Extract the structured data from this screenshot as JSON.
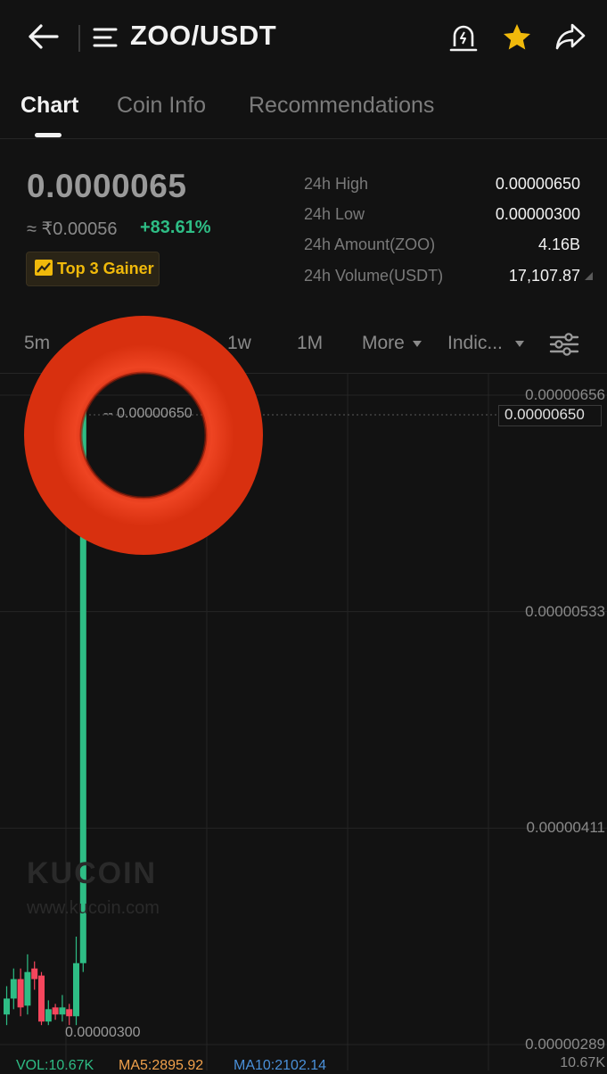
{
  "header": {
    "title": "ZOO/USDT"
  },
  "tabs": [
    {
      "label": "Chart",
      "active": true
    },
    {
      "label": "Coin Info",
      "active": false
    },
    {
      "label": "Recommendations",
      "active": false
    }
  ],
  "ticker": {
    "price": "0.0000065",
    "approx": "≈ ₹0.00056",
    "change": "+83.61%",
    "badge": "Top 3 Gainer",
    "stats": [
      {
        "label": "24h High",
        "value": "0.00000650"
      },
      {
        "label": "24h Low",
        "value": "0.00000300"
      },
      {
        "label": "24h Amount(ZOO)",
        "value": "4.16B"
      },
      {
        "label": "24h Volume(USDT)",
        "value": "17,107.87"
      }
    ]
  },
  "intervals": {
    "items": [
      "5m",
      "1w",
      "1M"
    ],
    "more": "More",
    "indicators": "Indic..."
  },
  "chart_data": {
    "type": "candlestick",
    "y_ticks": [
      "0.00000656",
      "0.00000533",
      "0.00000411",
      "0.00000289"
    ],
    "last_price_label": "0.00000650",
    "high_label": "0.00000650",
    "low_label": "0.00000300",
    "ylim": [
      2.89e-06,
      6.56e-06
    ],
    "candles": [
      {
        "o": 3.06e-06,
        "c": 3.15e-06,
        "h": 3.22e-06,
        "l": 3e-06
      },
      {
        "o": 3.15e-06,
        "c": 3.26e-06,
        "h": 3.32e-06,
        "l": 3.09e-06
      },
      {
        "o": 3.26e-06,
        "c": 3.1e-06,
        "h": 3.32e-06,
        "l": 3.05e-06
      },
      {
        "o": 3.11e-06,
        "c": 3.3e-06,
        "h": 3.4e-06,
        "l": 3.06e-06
      },
      {
        "o": 3.32e-06,
        "c": 3.26e-06,
        "h": 3.36e-06,
        "l": 3.2e-06
      },
      {
        "o": 3.28e-06,
        "c": 3.02e-06,
        "h": 3.3e-06,
        "l": 3e-06
      },
      {
        "o": 3.02e-06,
        "c": 3.09e-06,
        "h": 3.14e-06,
        "l": 3e-06
      },
      {
        "o": 3.1e-06,
        "c": 3.06e-06,
        "h": 3.12e-06,
        "l": 3.03e-06
      },
      {
        "o": 3.06e-06,
        "c": 3.1e-06,
        "h": 3.17e-06,
        "l": 3.02e-06
      },
      {
        "o": 3.09e-06,
        "c": 3.05e-06,
        "h": 3.12e-06,
        "l": 3e-06
      },
      {
        "o": 3.05e-06,
        "c": 3.35e-06,
        "h": 3.5e-06,
        "l": 3e-06
      },
      {
        "o": 3.35e-06,
        "c": 6.5e-06,
        "h": 6.5e-06,
        "l": 3.3e-06
      }
    ],
    "legend": {
      "vol": "VOL:10.67K",
      "ma5": "MA5:2895.92",
      "ma10": "MA10:2102.14",
      "vol_axis": "10.67K"
    }
  },
  "watermark": {
    "brand": "KUCOIN",
    "url": "www.kucoin.com"
  },
  "colors": {
    "up": "#2ebd85",
    "down": "#f6465d",
    "accent": "#f0b90b",
    "overlay_ring": "#e8361b",
    "ma5": "#f0a04b",
    "ma10": "#4a90d9"
  },
  "icons": {
    "back": "arrow-left-icon",
    "menu": "menu-icon",
    "alert": "price-alert-icon",
    "favorite": "star-icon",
    "share": "share-icon",
    "settings": "sliders-icon"
  }
}
